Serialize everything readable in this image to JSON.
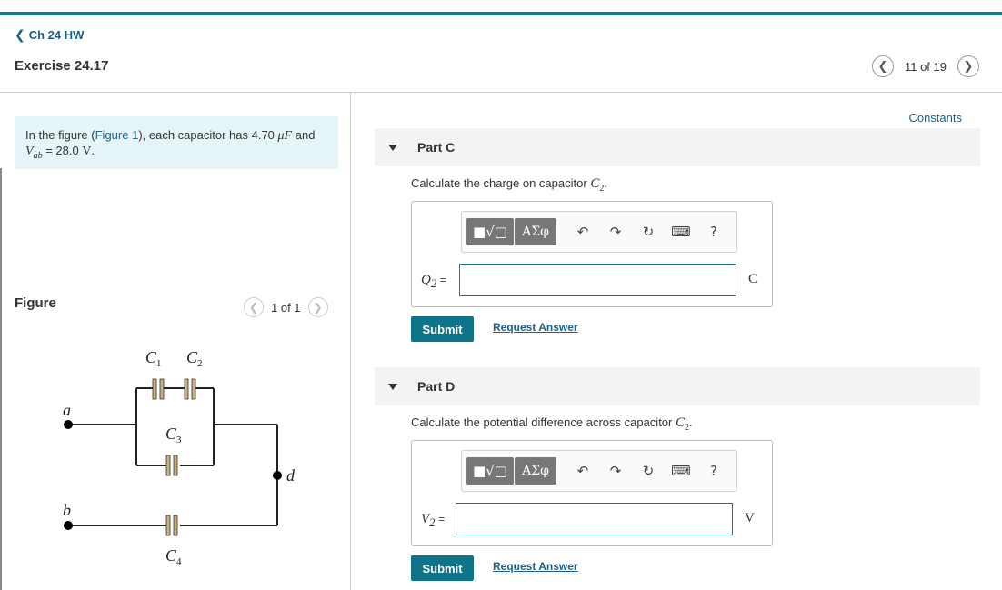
{
  "nav": {
    "back_label": "Ch 24 HW",
    "back_icon": "chevron-left-icon"
  },
  "exercise": {
    "title": "Exercise 24.17"
  },
  "pager": {
    "text": "11 of 19",
    "prev_icon": "‹",
    "next_icon": "›"
  },
  "intro": {
    "text_before": "In the figure (",
    "link": "Figure 1",
    "text_mid": "), each capacitor has 4.70",
    "unit_uf": "μF",
    "text_and": "and",
    "vab_var": "V",
    "vab_sub": "ab",
    "vab_rest": "= 28.0",
    "vab_unit": "V",
    "period": "."
  },
  "figure": {
    "heading": "Figure",
    "pager_text": "1 of 1",
    "labels": {
      "c1": "C",
      "c1_sub": "1",
      "c2": "C",
      "c2_sub": "2",
      "c3": "C",
      "c3_sub": "3",
      "c4": "C",
      "c4_sub": "4",
      "a": "a",
      "b": "b",
      "d": "d"
    }
  },
  "constants_link": "Constants",
  "toolbar": {
    "template_btn": "■√□",
    "symbols_btn": "ΑΣφ",
    "undo": "↶",
    "redo": "↷",
    "reset": "↻",
    "keyboard": "⌨",
    "help": "?"
  },
  "parts": [
    {
      "label": "Part C",
      "question": "Calculate the charge on capacitor",
      "q_var": "C",
      "q_sub": "2",
      "var": "Q",
      "var_sub": "2",
      "eq": "=",
      "unit": "C",
      "input_value": "",
      "submit": "Submit",
      "request": "Request Answer"
    },
    {
      "label": "Part D",
      "question": "Calculate the potential difference across capacitor",
      "q_var": "C",
      "q_sub": "2",
      "var": "V",
      "var_sub": "2",
      "eq": "=",
      "unit": "V",
      "input_value": "",
      "submit": "Submit",
      "request": "Request Answer"
    }
  ],
  "colors": {
    "accent": "#0f7c8c",
    "link": "#1c5f87",
    "intro_bg": "#e6f5f7",
    "button": "#0e7489"
  }
}
